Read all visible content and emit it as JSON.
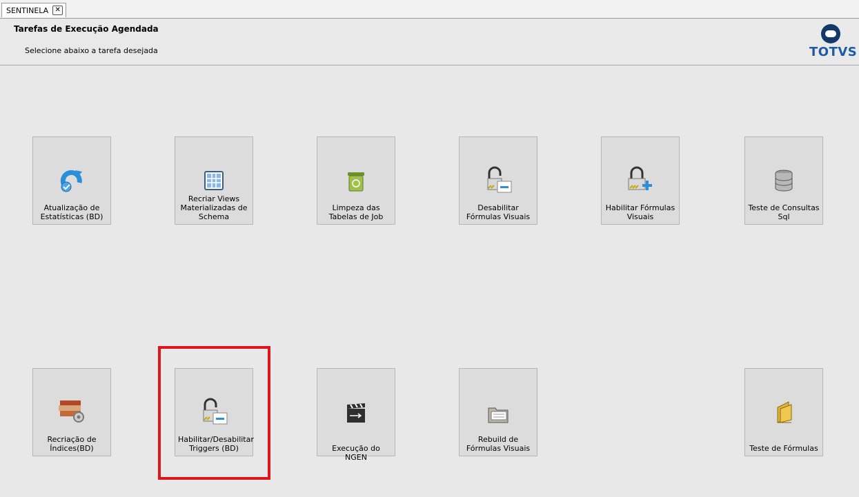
{
  "tab": {
    "label": "SENTINELA",
    "close": "✕"
  },
  "header": {
    "title": "Tarefas de Execução Agendada",
    "subtitle": "Selecione abaixo a tarefa desejada",
    "brand": "TOTVS"
  },
  "tasks": [
    {
      "label": "Atualização de\nEstatísticas (BD)",
      "icon": "refresh-arrow-icon"
    },
    {
      "label": "Recriar Views\nMaterializadas de\nSchema",
      "icon": "grid-table-icon"
    },
    {
      "label": "Limpeza das\nTabelas de Job",
      "icon": "recycle-bin-icon"
    },
    {
      "label": "Desabilitar\nFórmulas Visuais",
      "icon": "lock-minus-icon"
    },
    {
      "label": "Habilitar Fórmulas\nVisuais",
      "icon": "lock-plus-icon"
    },
    {
      "label": "Teste de Consultas\nSql",
      "icon": "database-icon"
    },
    {
      "label": "Recriação de\nÍndices(BD)",
      "icon": "books-gear-icon"
    },
    {
      "label": "Habilitar/Desabilitar\nTriggers (BD)",
      "icon": "lock-minus-icon"
    },
    {
      "label": "Execução do NGEN",
      "icon": "clapperboard-icon"
    },
    {
      "label": "Rebuild de\nFórmulas Visuais",
      "icon": "folder-icon"
    },
    {
      "label": "Teste de Fórmulas",
      "icon": "yellow-folder-icon"
    }
  ],
  "colors": {
    "highlight": "#e0141e",
    "brand": "#1e5aa8"
  }
}
